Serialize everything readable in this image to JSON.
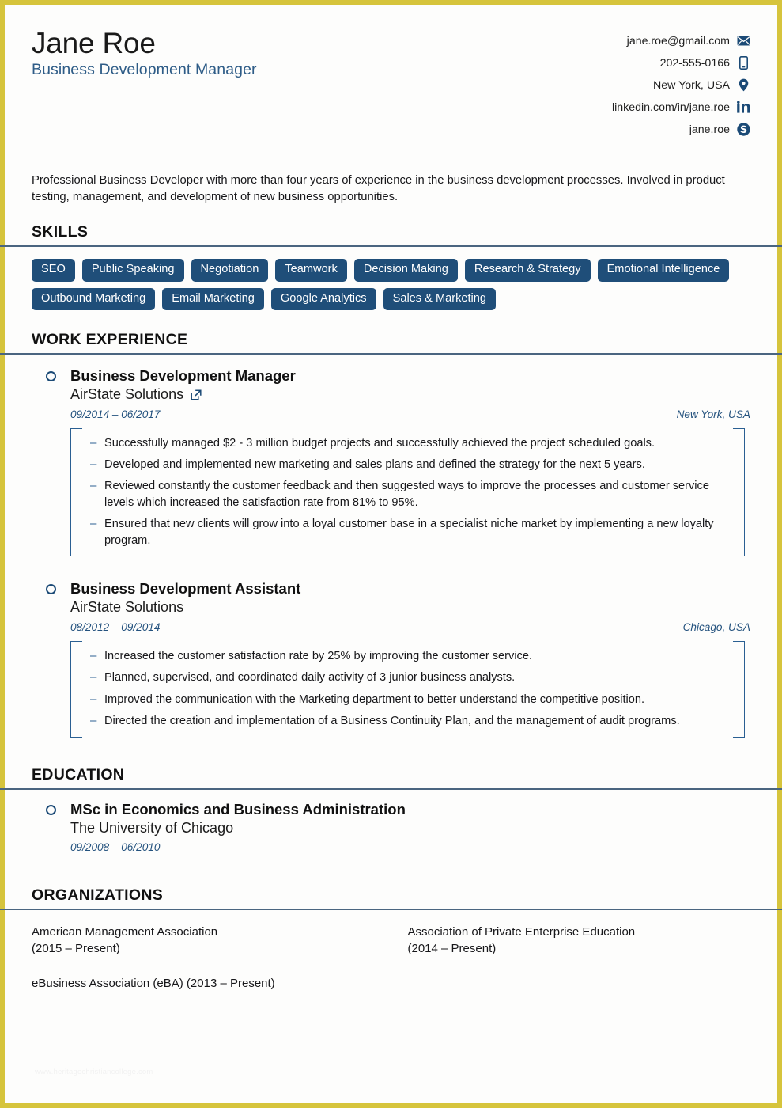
{
  "theme": {
    "frame_color": "#d6c43c",
    "accent_blue": "#1f4e79",
    "rule_color": "#4a6580",
    "link_blue": "#24527e"
  },
  "header": {
    "name": "Jane Roe",
    "job_title": "Business Development Manager",
    "contacts": [
      {
        "text": "jane.roe@gmail.com",
        "icon": "envelope-icon"
      },
      {
        "text": "202-555-0166",
        "icon": "mobile-phone-icon"
      },
      {
        "text": "New York, USA",
        "icon": "location-pin-icon"
      },
      {
        "text": "linkedin.com/in/jane.roe",
        "icon": "linkedin-icon"
      },
      {
        "text": "jane.roe",
        "icon": "skype-icon"
      }
    ]
  },
  "summary": {
    "text": "Professional Business Developer with more than four years of experience in the business development processes. Involved in product testing, management, and development of new business opportunities."
  },
  "skills": {
    "heading": "SKILLS",
    "tags": [
      "SEO",
      "Public Speaking",
      "Negotiation",
      "Teamwork",
      "Decision Making",
      "Research & Strategy",
      "Emotional Intelligence",
      "Outbound Marketing",
      "Email Marketing",
      "Google Analytics",
      "Sales & Marketing"
    ]
  },
  "work_experience": {
    "heading": "WORK EXPERIENCE",
    "entries": [
      {
        "role": "Business Development Manager",
        "organization": "AirState Solutions",
        "has_link": true,
        "date": "09/2014 – 06/2017",
        "location": "New York, USA",
        "bullets": [
          "Successfully managed $2 - 3 million budget projects and successfully achieved the project scheduled goals.",
          "Developed and implemented new marketing and sales plans and defined the strategy for the next 5 years.",
          "Reviewed constantly the customer feedback and then suggested ways to improve the processes and customer service levels which increased the satisfaction rate from 81% to 95%.",
          "Ensured that new clients will grow into a loyal customer base in a specialist niche market by implementing a new loyalty program."
        ]
      },
      {
        "role": "Business Development Assistant",
        "organization": "AirState Solutions",
        "has_link": false,
        "date": "08/2012 – 09/2014",
        "location": "Chicago, USA",
        "bullets": [
          "Increased the customer satisfaction rate by 25% by improving the customer service.",
          "Planned, supervised, and coordinated daily activity of 3 junior business analysts.",
          "Improved the communication with the Marketing department to better understand the competitive position.",
          "Directed the creation and implementation of a Business Continuity Plan, and the management of audit programs."
        ]
      }
    ]
  },
  "education": {
    "heading": "EDUCATION",
    "entries": [
      {
        "degree": "MSc in Economics and Business Administration",
        "school": "The University of Chicago",
        "date": "09/2008 – 06/2010"
      }
    ]
  },
  "organizations": {
    "heading": "ORGANIZATIONS",
    "items": [
      "American Management Association\n(2015 – Present)",
      "Association of Private Enterprise Education\n(2014 – Present)",
      "eBusiness Association (eBA) (2013 – Present)"
    ]
  },
  "watermark": {
    "text": "www.heritagechristiancollege.com"
  }
}
